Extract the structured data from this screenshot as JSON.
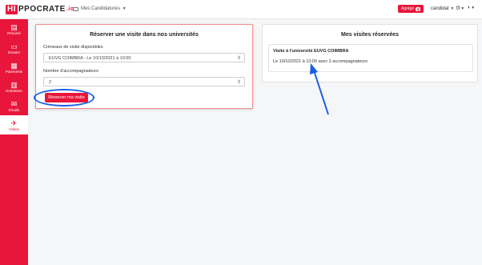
{
  "brand": {
    "hi": "HI",
    "rest": "PPOCRATE",
    "io": ".io"
  },
  "topbar": {
    "nav_label": "Mes Candidatures",
    "agrege_label": "Agrégé",
    "user_label": "candidat",
    "settings_icon": "gear-icon",
    "language_icon": "globe-icon"
  },
  "sidebar": {
    "items": [
      {
        "label": "Résumé",
        "icon": "resume-icon",
        "glyph": "▤"
      },
      {
        "label": "Dossier",
        "icon": "folder-icon",
        "glyph": "▭"
      },
      {
        "label": "Paiements",
        "icon": "payments-icon",
        "glyph": "▦"
      },
      {
        "label": "Entretiens",
        "icon": "calendar-icon",
        "glyph": "▥"
      },
      {
        "label": "Emails",
        "icon": "email-icon",
        "glyph": "✉"
      },
      {
        "label": "Visites",
        "icon": "plane-icon",
        "glyph": "✈"
      }
    ]
  },
  "reserve": {
    "title": "Réserver une visite dans nos universités",
    "slots_label": "Créneaux de visite disponibles",
    "slots_value": "EUVG COIMBRA - Le 10/10/2021 à 10:00",
    "companions_label": "Nombre d'accompagnateurs",
    "companions_value": "2",
    "button_label": "Réserver ma visite"
  },
  "booked": {
    "title": "Mes visites réservées",
    "visit_title": "Visite à l'université EUVG COIMBRA",
    "visit_detail": "Le 10/10/2021 à 10:00 avec 2 accompagnateurs"
  },
  "colors": {
    "accent": "#e8163a",
    "annotation": "#1a5fe0"
  }
}
